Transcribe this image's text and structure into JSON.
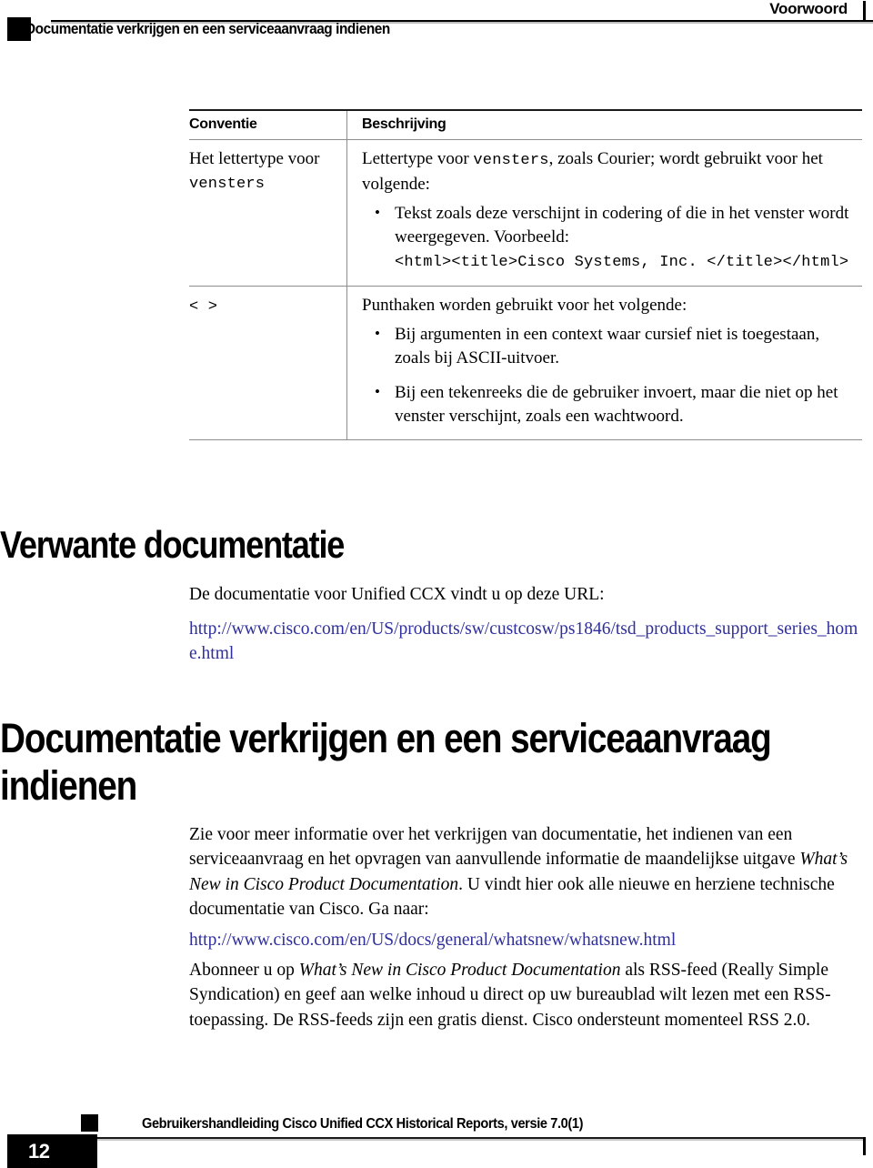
{
  "header": {
    "running_title": "Voorwoord",
    "chapter_title": "Documentatie verkrijgen en een serviceaanvraag indienen"
  },
  "conventions_table": {
    "columns": [
      "Conventie",
      "Beschrijving"
    ],
    "rows": [
      {
        "convention_text": "Het lettertype voor",
        "convention_mono": "vensters",
        "description_intro_a": "Lettertype voor ",
        "description_intro_mono": "vensters",
        "description_intro_b": ", zoals Courier; wordt gebruikt voor het volgende:",
        "bullets": [
          {
            "text": "Tekst zoals deze verschijnt in codering of die in het venster wordt weergegeven. Voorbeeld: ",
            "code": "<html><title>Cisco Systems, Inc. </title></html>"
          }
        ]
      },
      {
        "convention_mono": "< >",
        "description_intro_b": "Punthaken worden gebruikt voor het volgende:",
        "bullets": [
          {
            "text": "Bij argumenten in een context waar cursief niet is toegestaan, zoals bij ASCII-uitvoer."
          },
          {
            "text": "Bij een tekenreeks die de gebruiker invoert, maar die niet op het venster verschijnt, zoals een wachtwoord."
          }
        ]
      }
    ]
  },
  "sections": {
    "related_docs": {
      "heading": "Verwante documentatie",
      "intro": "De documentatie voor Unified CCX vindt u op deze URL:",
      "url": "http://www.cisco.com/en/US/products/sw/custcosw/ps1846/tsd_products_support_series_home.html"
    },
    "obtaining_docs": {
      "heading": "Documentatie verkrijgen en een serviceaanvraag indienen",
      "paragraph_1_a": "Zie voor meer informatie over het verkrijgen van documentatie, het indienen van een serviceaanvraag en het opvragen van aanvullende informatie de maandelijkse uitgave ",
      "paragraph_1_italic": "What’s New in Cisco Product Documentation",
      "paragraph_1_b": ". U vindt hier ook alle nieuwe en herziene technische documentatie van Cisco. Ga naar:",
      "url": "http://www.cisco.com/en/US/docs/general/whatsnew/whatsnew.html",
      "paragraph_2_a": "Abonneer u op ",
      "paragraph_2_italic": "What’s New in Cisco Product Documentation",
      "paragraph_2_b": " als RSS-feed (Really Simple Syndication) en geef aan welke inhoud u direct op uw bureaublad wilt lezen met een RSS-toepassing. De RSS-feeds zijn een gratis dienst. Cisco ondersteunt momenteel RSS 2.0."
    }
  },
  "footer": {
    "document_title": "Gebruikershandleiding Cisco Unified CCX Historical Reports, versie 7.0(1)",
    "page_number": "12"
  },
  "colors": {
    "link": "#2f2f9c",
    "rule_dark": "#1a1a1a",
    "rule_light": "#c9c9c9",
    "table_border": "#8d8d8d"
  }
}
